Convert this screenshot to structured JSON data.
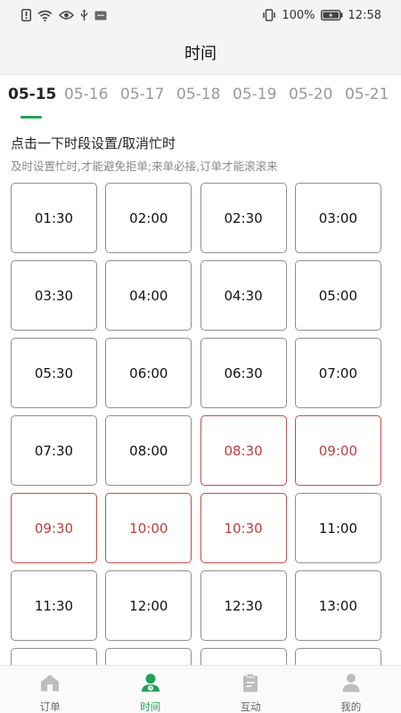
{
  "status_bar": {
    "battery": "100%",
    "time": "12:58"
  },
  "header": {
    "title": "时间"
  },
  "date_tabs": {
    "selected": "05-15",
    "items": [
      "05-15",
      "05-16",
      "05-17",
      "05-18",
      "05-19",
      "05-20",
      "05-21"
    ]
  },
  "notice": {
    "title": "点击一下时段设置/取消忙时",
    "subtitle": "及时设置忙时,才能避免拒单;来单必接,订单才能滚滚来"
  },
  "slots": [
    {
      "time": "01:30",
      "busy": false
    },
    {
      "time": "02:00",
      "busy": false
    },
    {
      "time": "02:30",
      "busy": false
    },
    {
      "time": "03:00",
      "busy": false
    },
    {
      "time": "03:30",
      "busy": false
    },
    {
      "time": "04:00",
      "busy": false
    },
    {
      "time": "04:30",
      "busy": false
    },
    {
      "time": "05:00",
      "busy": false
    },
    {
      "time": "05:30",
      "busy": false
    },
    {
      "time": "06:00",
      "busy": false
    },
    {
      "time": "06:30",
      "busy": false
    },
    {
      "time": "07:00",
      "busy": false
    },
    {
      "time": "07:30",
      "busy": false
    },
    {
      "time": "08:00",
      "busy": false
    },
    {
      "time": "08:30",
      "busy": true
    },
    {
      "time": "09:00",
      "busy": true
    },
    {
      "time": "09:30",
      "busy": true
    },
    {
      "time": "10:00",
      "busy": true
    },
    {
      "time": "10:30",
      "busy": true
    },
    {
      "time": "11:00",
      "busy": false
    },
    {
      "time": "11:30",
      "busy": false
    },
    {
      "time": "12:00",
      "busy": false
    },
    {
      "time": "12:30",
      "busy": false
    },
    {
      "time": "13:00",
      "busy": false
    },
    {
      "time": "",
      "busy": false
    },
    {
      "time": "",
      "busy": false
    },
    {
      "time": "",
      "busy": false
    },
    {
      "time": "",
      "busy": false
    }
  ],
  "colors": {
    "accent": "#1fa355",
    "busy_border": "#c94b4b",
    "busy_text": "#c23b3b",
    "normal_border": "#8f8f8f"
  },
  "bottom_nav": {
    "active": "时间",
    "items": [
      {
        "label": "订单",
        "icon": "home-icon"
      },
      {
        "label": "时间",
        "icon": "person-clock-icon"
      },
      {
        "label": "互动",
        "icon": "clipboard-icon"
      },
      {
        "label": "我的",
        "icon": "user-icon"
      }
    ]
  }
}
